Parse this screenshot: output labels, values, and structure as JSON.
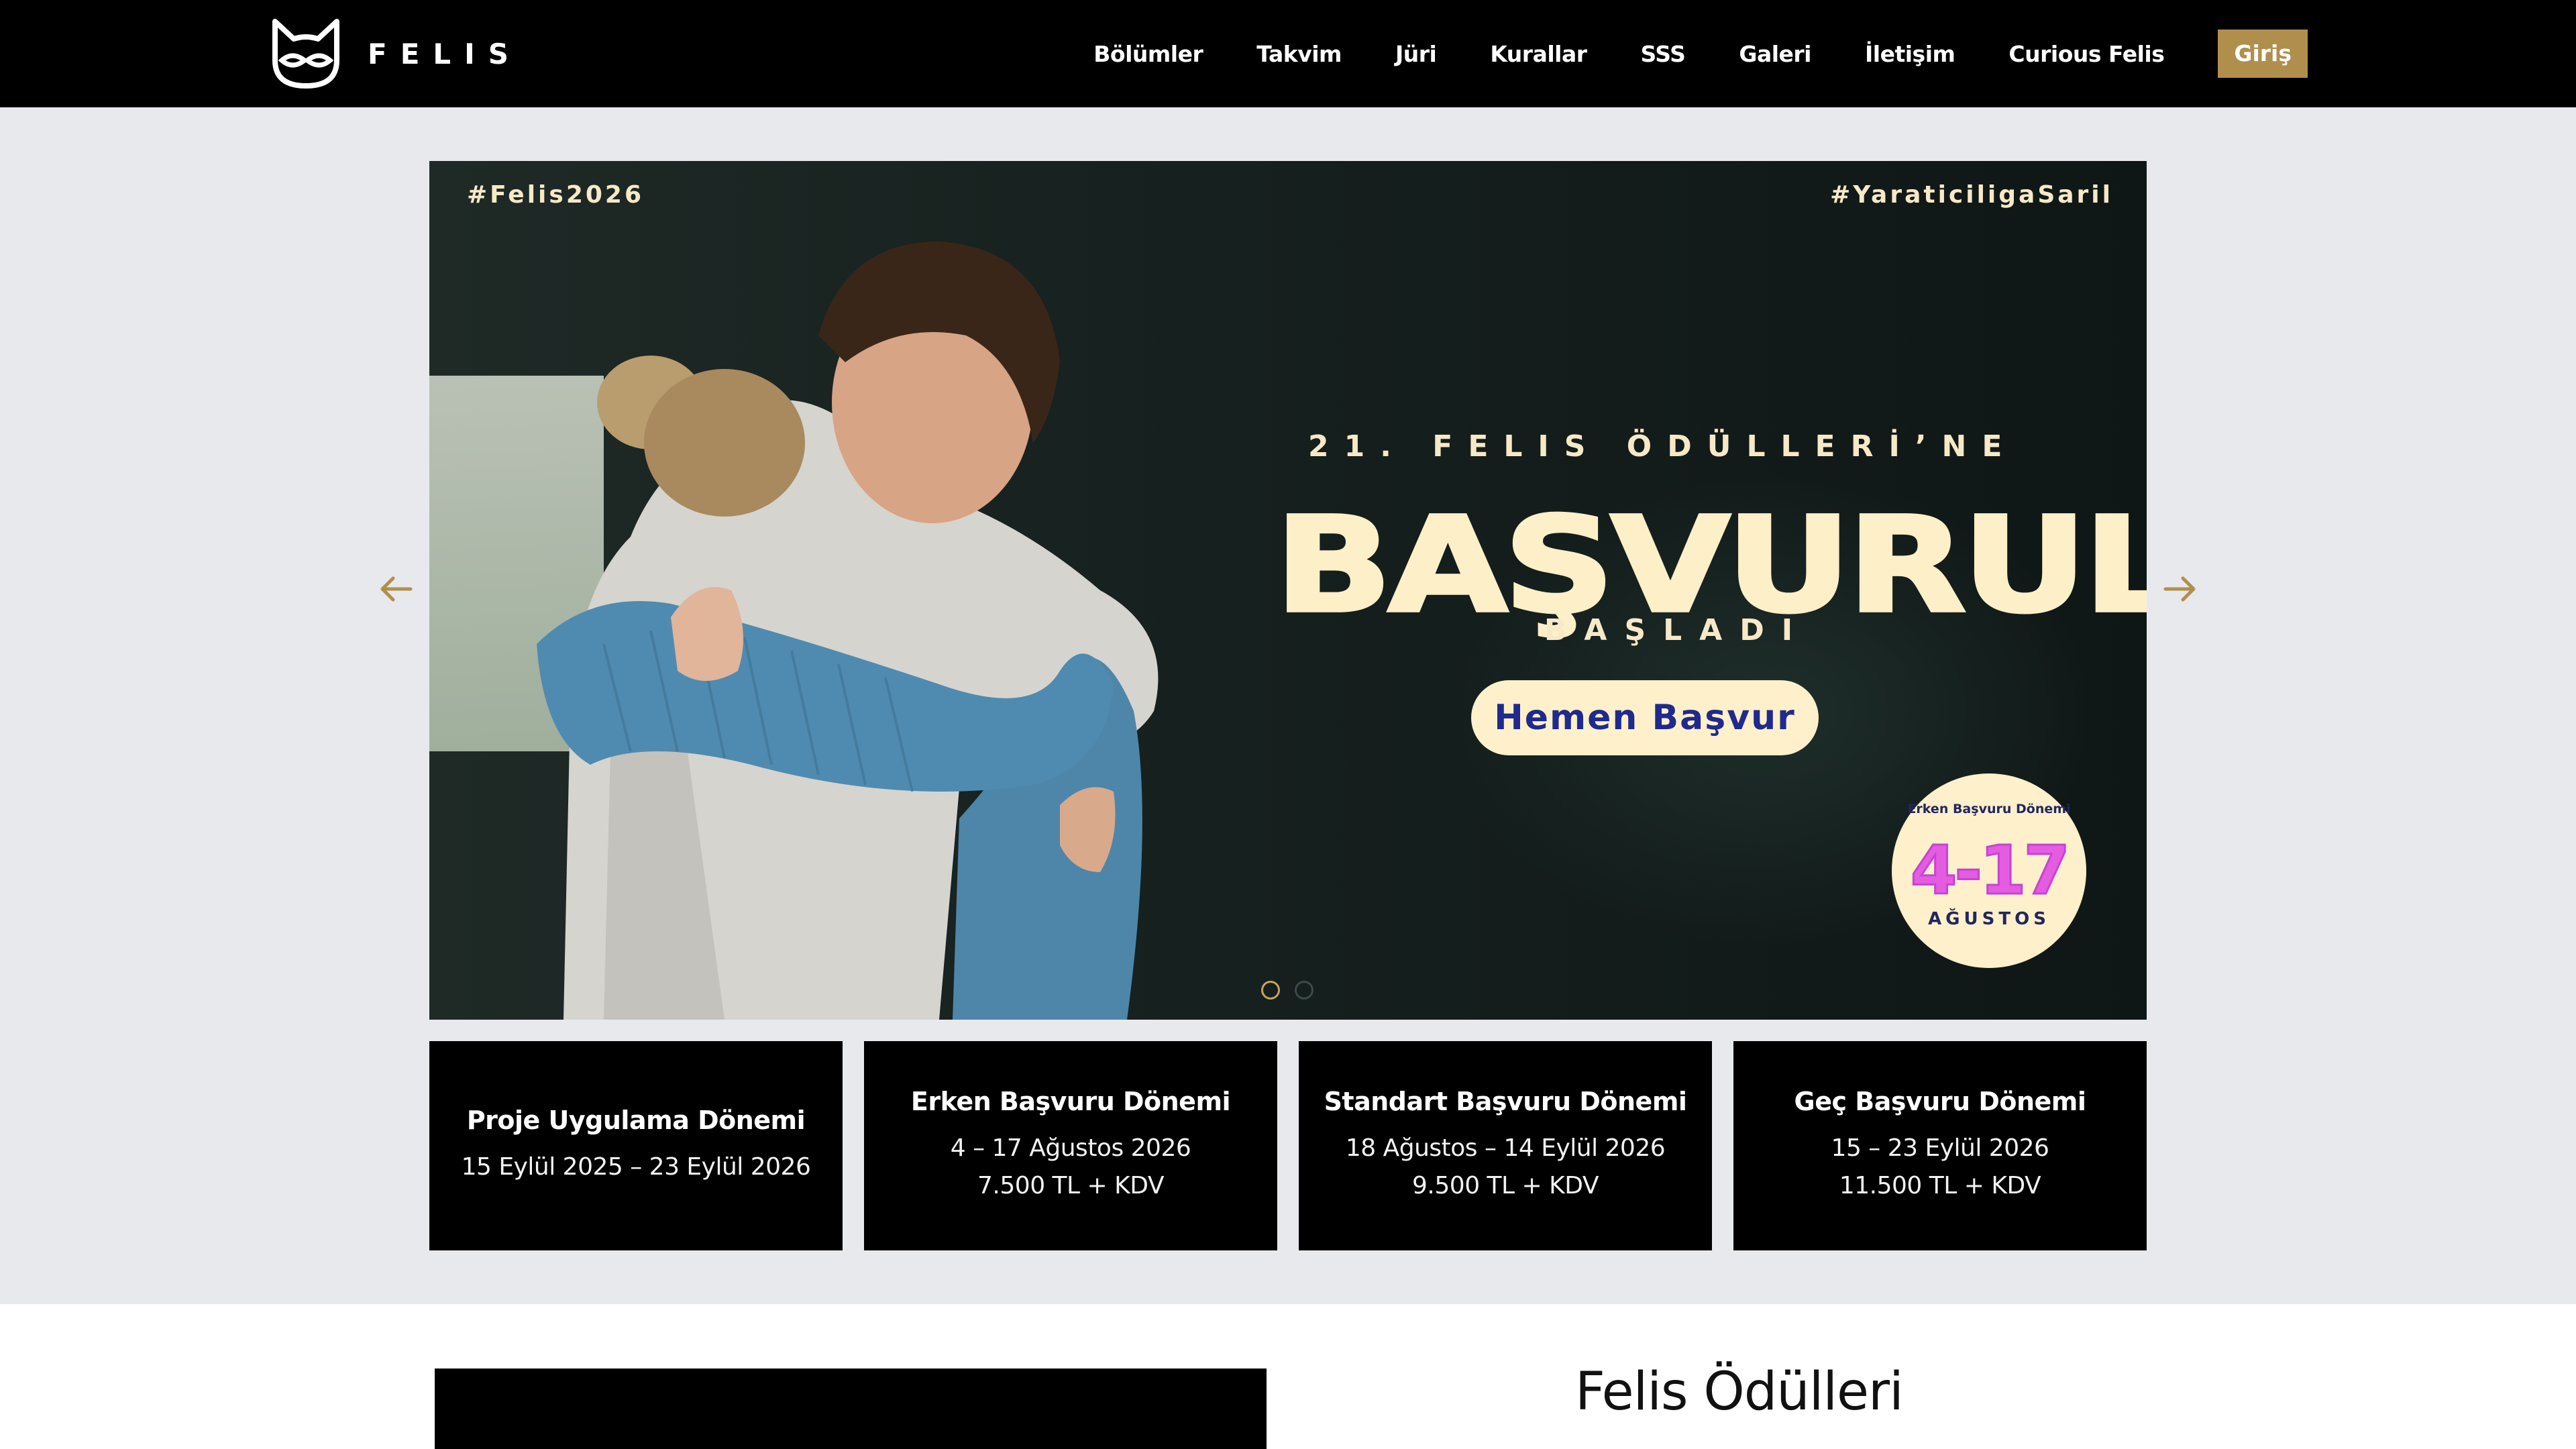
{
  "header": {
    "brand": "FELIS",
    "nav": [
      "Bölümler",
      "Takvim",
      "Jüri",
      "Kurallar",
      "SSS",
      "Galeri",
      "İletişim",
      "Curious Felis"
    ],
    "login_label": "Giriş"
  },
  "hero": {
    "hashtag_left": "#Felis2026",
    "hashtag_right": "#YaraticiligaSaril",
    "kicker": "21. FELIS ÖDÜLLERİ’NE",
    "title": "BAŞVURULAR",
    "subtitle": "BAŞLADI",
    "cta_label": "Hemen Başvur",
    "badge": {
      "top": "Erken Başvuru Dönemi",
      "range": "4-17",
      "month": "AĞUSTOS"
    },
    "slide_count": 2,
    "active_slide": 1
  },
  "cards": [
    {
      "title": "Proje Uygulama Dönemi",
      "lines": [
        "15 Eylül 2025 – 23 Eylül 2026"
      ]
    },
    {
      "title": "Erken Başvuru Dönemi",
      "lines": [
        "4 – 17 Ağustos 2026",
        "7.500 TL + KDV"
      ]
    },
    {
      "title": "Standart Başvuru Dönemi",
      "lines": [
        "18 Ağustos – 14 Eylül 2026",
        "9.500 TL + KDV"
      ]
    },
    {
      "title": "Geç Başvuru Dönemi",
      "lines": [
        "15 – 23 Eylül 2026",
        "11.500 TL + KDV"
      ]
    }
  ],
  "lower": {
    "section_title": "Felis Ödülleri"
  },
  "colors": {
    "accent_gold": "#b08f4d",
    "cream": "#fdf0cb",
    "cta_text": "#1f2a8c",
    "badge_pink": "#e55ce0"
  }
}
